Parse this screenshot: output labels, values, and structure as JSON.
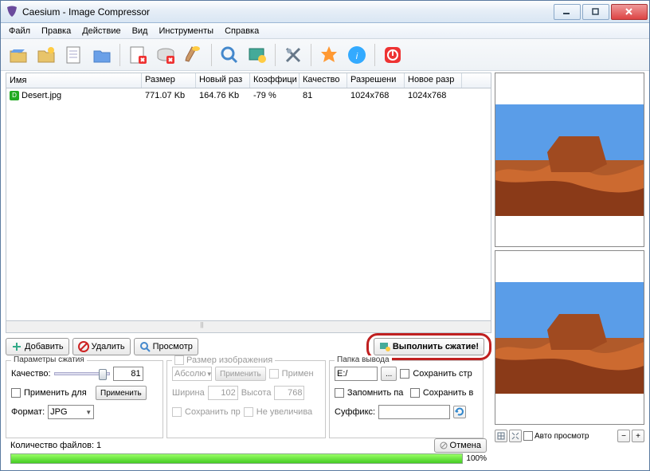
{
  "window": {
    "title": "Caesium - Image Compressor"
  },
  "menu": {
    "file": "Файл",
    "edit": "Правка",
    "action": "Действие",
    "view": "Вид",
    "tools": "Инструменты",
    "help": "Справка"
  },
  "columns": {
    "name": "Имя",
    "size": "Размер",
    "newsize": "Новый раз",
    "ratio": "Коэффици",
    "quality": "Качество",
    "res": "Разрешени",
    "newres": "Новое разр"
  },
  "row1": {
    "name": "Desert.jpg",
    "size": "771.07 Kb",
    "newsize": "164.76 Kb",
    "ratio": "-79 %",
    "quality": "81",
    "res": "1024x768",
    "newres": "1024x768"
  },
  "actions": {
    "add": "Добавить",
    "remove": "Удалить",
    "preview": "Просмотр",
    "compress": "Выполнить сжатие!"
  },
  "grp_compress": {
    "title": "Параметры сжатия",
    "quality_label": "Качество:",
    "quality_value": "81",
    "apply_all": "Применить для",
    "apply_btn": "Применить",
    "format_label": "Формат:",
    "format_value": "JPG"
  },
  "grp_resize": {
    "title": "Размер изображения",
    "abs": "Абсолю",
    "apply_btn": "Применить",
    "apply_chk": "Примен",
    "width_label": "Ширина",
    "width_value": "102",
    "height_label": "Высота",
    "height_value": "768",
    "keep": "Сохранить пр",
    "noenlarge": "Не увеличива"
  },
  "grp_output": {
    "title": "Папка вывода",
    "path": "E:/",
    "keep_struct": "Сохранить стр",
    "remember": "Запомнить па",
    "save_to": "Сохранить в",
    "suffix_label": "Суффикс:",
    "suffix_value": ""
  },
  "status": {
    "count_label": "Количество файлов: 1",
    "cancel": "Отмена",
    "percent": "100%"
  },
  "footer": {
    "autopreview": "Авто просмотр"
  }
}
